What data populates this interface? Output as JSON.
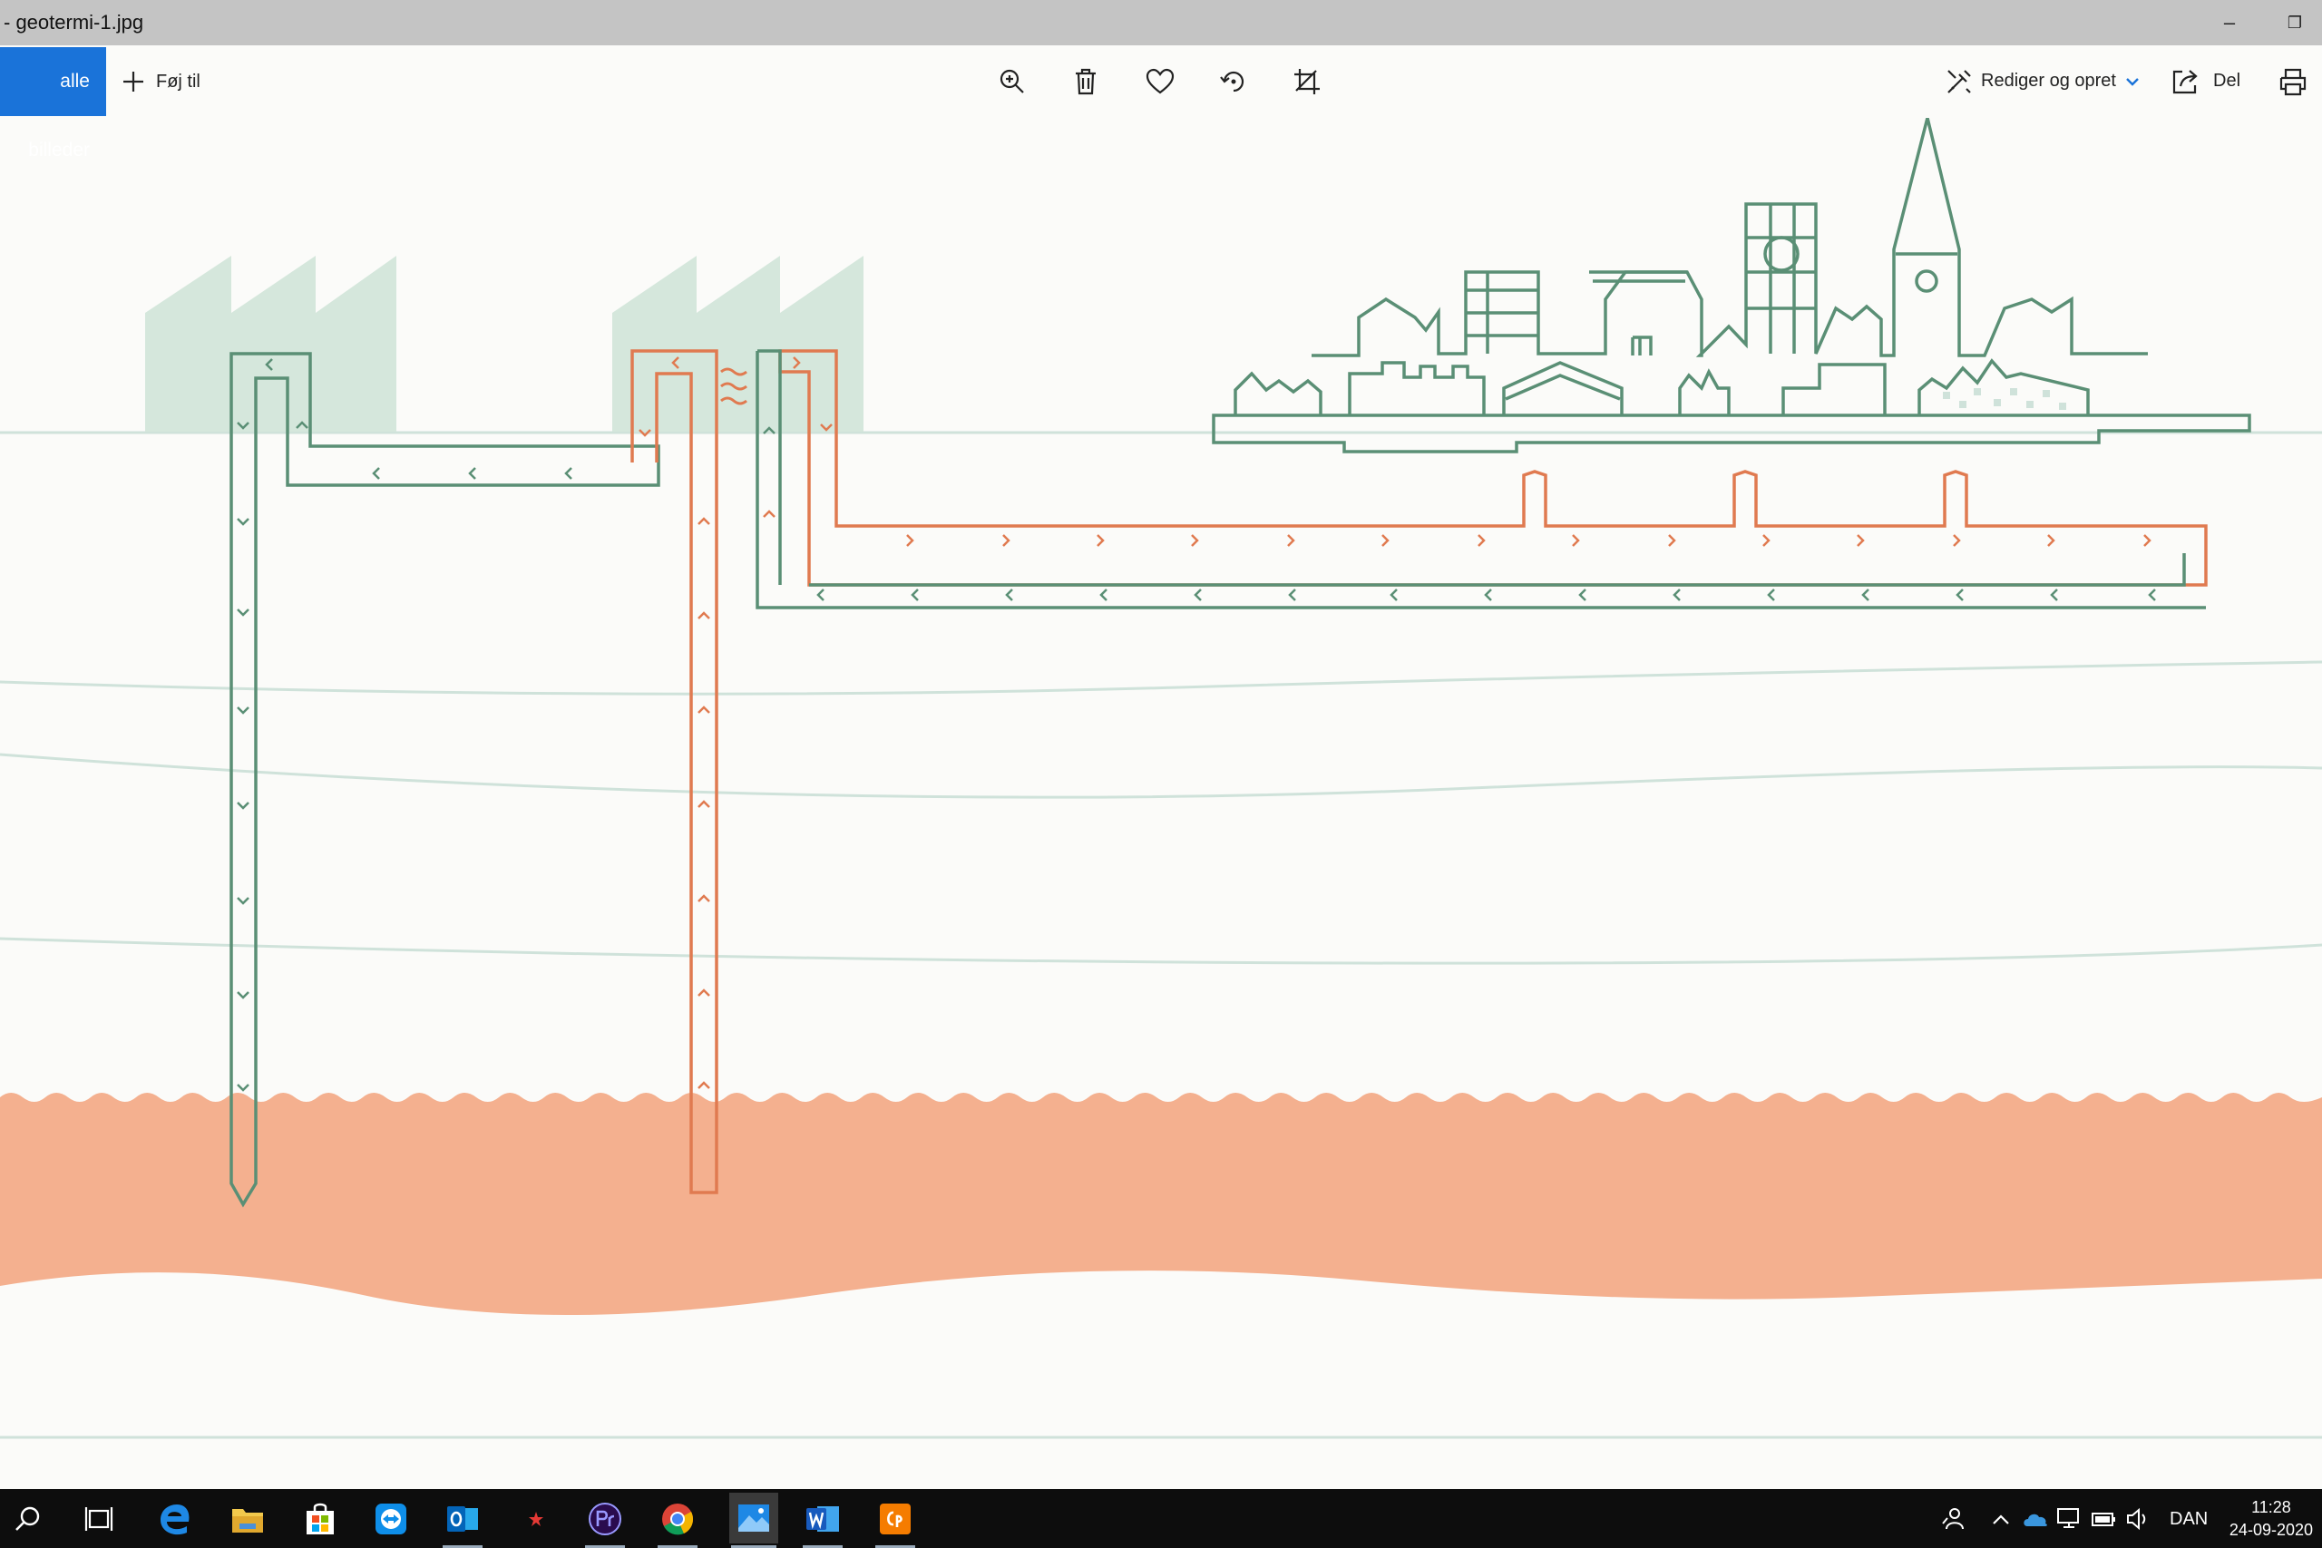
{
  "window": {
    "title": "- geotermi-1.jpg",
    "minimize_glyph": "–",
    "restore_glyph": "❐"
  },
  "toolbar": {
    "all_photos_label": "alle billeder",
    "add_label": "Føj til",
    "edit_create_label": "Rediger og opret",
    "share_label": "Del",
    "icons": [
      "zoom-in-icon",
      "delete-icon",
      "heart-icon",
      "rotate-icon",
      "crop-icon",
      "edit-create-icon",
      "share-icon",
      "print-icon"
    ]
  },
  "colors": {
    "accent_blue": "#1a73d9",
    "green_line": "#5a8f75",
    "orange_line": "#e07a50",
    "factory_fill": "#d5e7dc",
    "rock_layer": "#f4b08f",
    "strata_line": "#cfe2da"
  },
  "taskbar": {
    "apps": [
      "search-icon",
      "task-view-icon",
      "edge-icon",
      "file-explorer-icon",
      "store-icon",
      "teamviewer-icon",
      "outlook-icon",
      "star-app-icon",
      "premiere-icon",
      "chrome-icon",
      "photos-icon",
      "word-icon",
      "captivate-icon"
    ],
    "language": "DAN",
    "time": "11:28",
    "date": "24-09-2020"
  }
}
